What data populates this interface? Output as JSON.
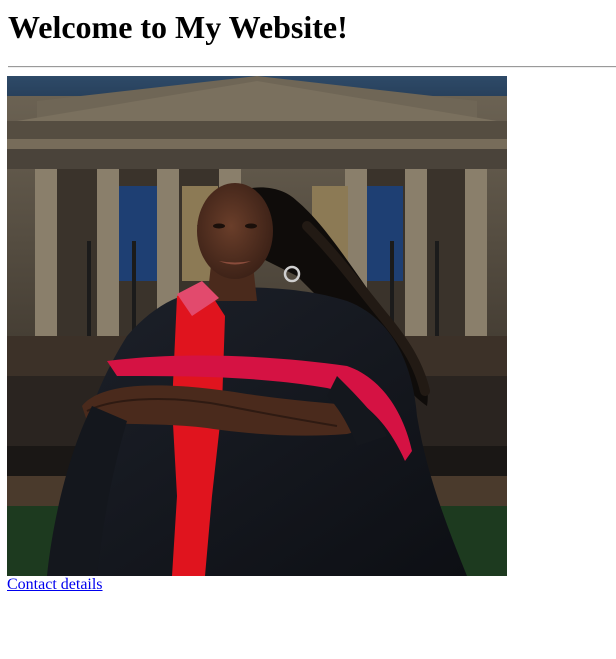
{
  "page": {
    "heading": "Welcome to My Website!",
    "link_text": "Contact details"
  },
  "photo": {
    "subject": "graduate-portrait",
    "colors": {
      "sky": "#243a52",
      "building": "#5a5246",
      "banner": "#1e3f73",
      "gown": "#14171d",
      "sash": "#d51243",
      "dress": "#e0141e",
      "skin": "#4a2a1c",
      "grass": "#1d3a1f"
    }
  },
  "colors": {
    "link": "#0000ee",
    "rule": "#9a9a9a"
  }
}
